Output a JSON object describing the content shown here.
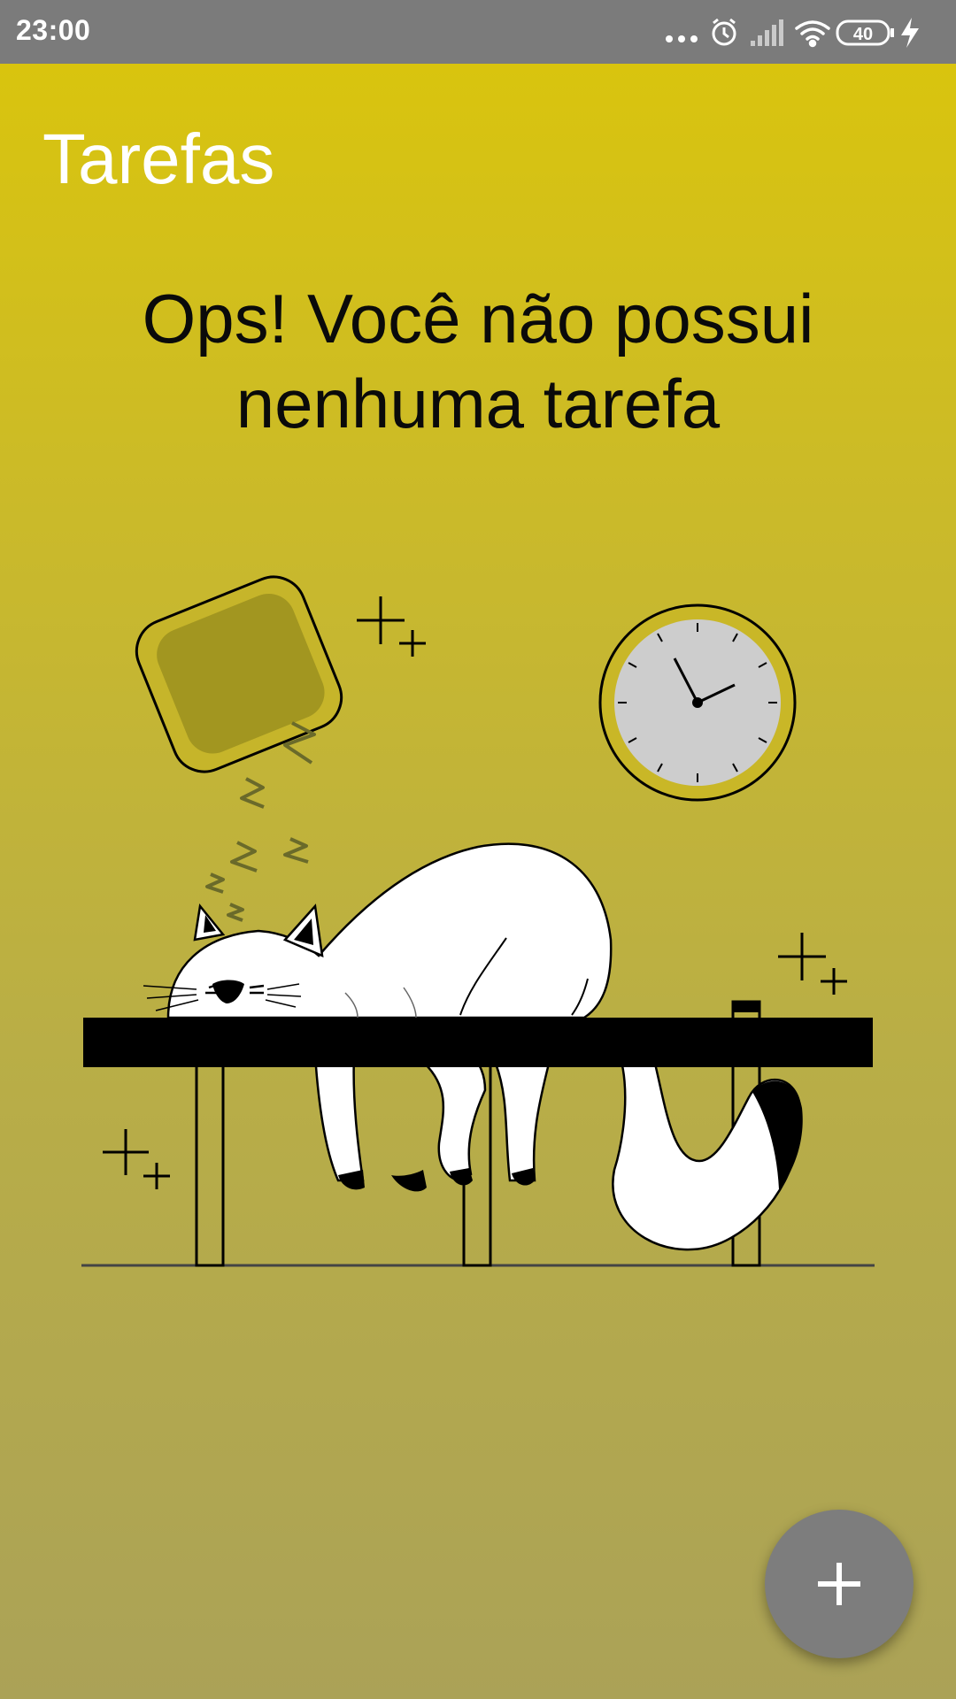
{
  "status_bar": {
    "time": "23:00",
    "battery_level": "40",
    "icons": [
      "more-dots-icon",
      "alarm-icon",
      "signal-icon",
      "wifi-icon",
      "battery-icon",
      "charging-icon"
    ]
  },
  "header": {
    "title": "Tarefas"
  },
  "empty_state": {
    "line1": "Ops! Você não possui",
    "line2": "nenhuma tarefa",
    "illustration": "sleeping-cat-on-table"
  },
  "fab": {
    "icon": "plus-icon"
  },
  "colors": {
    "status_bar": "#7b7b7b",
    "background_top": "#d9c40e",
    "background_bottom": "#aba257",
    "title_text": "#ffffff",
    "fab": "#7d7d7d"
  }
}
